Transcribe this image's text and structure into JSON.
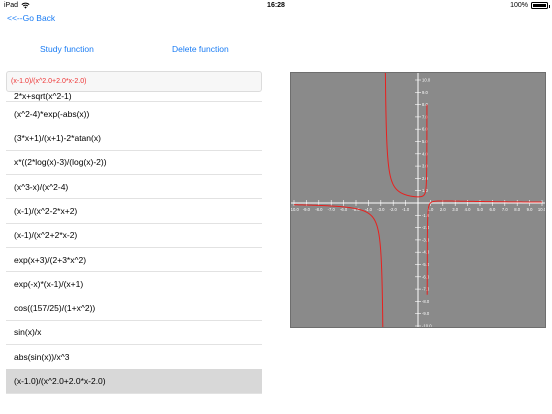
{
  "status_bar": {
    "device": "iPad",
    "time": "16:28",
    "battery": "100%"
  },
  "nav": {
    "back_label": "<<--Go Back"
  },
  "toolbar": {
    "study_label": "Study function",
    "delete_label": "Delete function"
  },
  "expression_input": {
    "value": "(x-1.0)/(x^2.0+2.0*x-2.0)"
  },
  "function_list": {
    "partial_item": "2*x+sqrt(x^2-1)",
    "items": [
      "(x^2-4)*exp(-abs(x))",
      "(3*x+1)/(x+1)-2*atan(x)",
      "x*((2*log(x)-3)/(log(x)-2))",
      "(x^3-x)/(x^2-4)",
      "(x-1)/(x^2-2*x+2)",
      "(x-1)/(x^2+2*x-2)",
      "exp(x+3)/(2+3*x^2)",
      "exp(-x)*(x-1)/(x+1)",
      "cos((157/25)/(1+x^2))",
      "sin(x)/x",
      "abs(sin(x))/x^3",
      "(x-1.0)/(x^2.0+2.0*x-2.0)"
    ],
    "selected_index": 11
  },
  "chart_data": {
    "type": "line",
    "function": "(x-1.0)/(x^2.0+2.0*x-2.0)",
    "xlim": [
      -10,
      10
    ],
    "ylim": [
      -10,
      10
    ],
    "x_ticks": [
      "-10.0",
      "-9.0",
      "-8.0",
      "-7.0",
      "-6.0",
      "-5.0",
      "-4.0",
      "-3.0",
      "-2.0",
      "-1.0",
      "1.0",
      "2.0",
      "3.0",
      "4.0",
      "5.0",
      "6.0",
      "7.0",
      "8.0",
      "9.0",
      "10.0"
    ],
    "y_ticks": [
      "10.0",
      "9.0",
      "8.0",
      "7.0",
      "6.0",
      "5.0",
      "4.0",
      "3.0",
      "2.0",
      "1.0",
      "-1.0",
      "-2.0",
      "-3.0",
      "-4.0",
      "-5.0",
      "-6.0",
      "-7.0",
      "-8.0",
      "-9.0",
      "-10.0"
    ],
    "asymptotes_x": [
      -2.732,
      0.732
    ],
    "colors": {
      "background": "#8a8a8a",
      "axis": "#ffffff",
      "curve": "#e8201e"
    }
  }
}
